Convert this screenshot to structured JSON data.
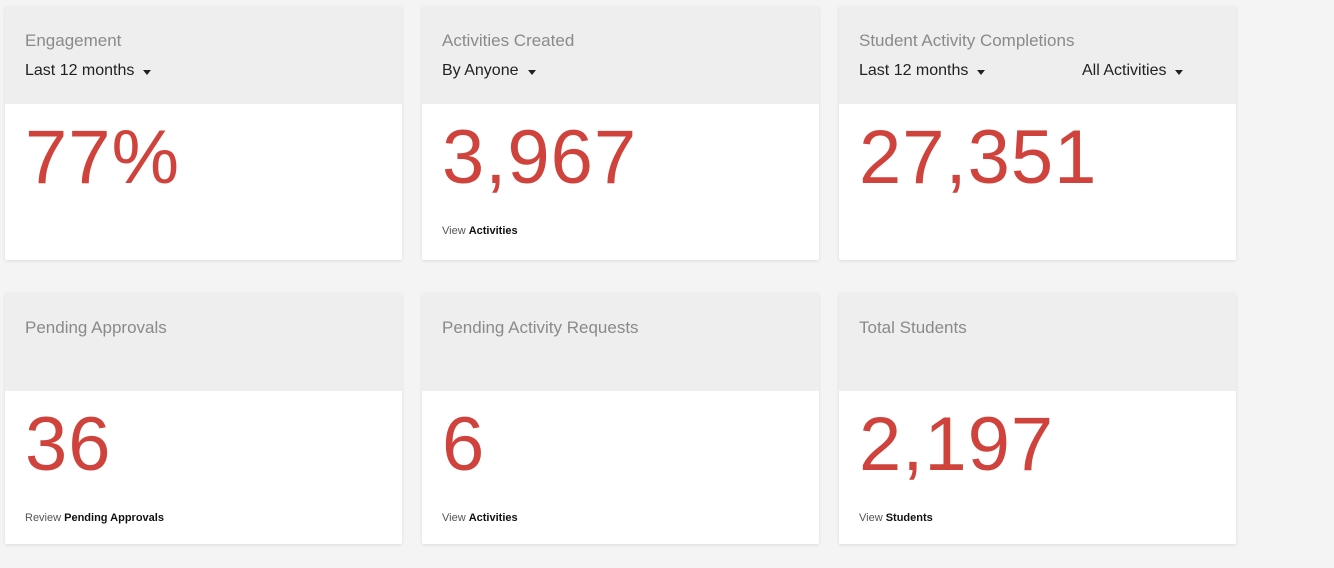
{
  "cards": [
    {
      "title": "Engagement",
      "dropdown1": "Last 12 months",
      "value": "77%"
    },
    {
      "title": "Activities Created",
      "dropdown1": "By Anyone",
      "value": "3,967",
      "link_prefix": "View",
      "link_label": "Activities"
    },
    {
      "title": "Student Activity Completions",
      "dropdown1": "Last 12 months",
      "dropdown2": "All Activities",
      "value": "27,351"
    },
    {
      "title": "Pending Approvals",
      "value": "36",
      "link_prefix": "Review",
      "link_label": "Pending Approvals"
    },
    {
      "title": "Pending Activity Requests",
      "value": "6",
      "link_prefix": "View",
      "link_label": "Activities"
    },
    {
      "title": "Total Students",
      "value": "2,197",
      "link_prefix": "View",
      "link_label": "Students"
    }
  ],
  "colors": {
    "accent": "#d0433c",
    "header_bg": "#eeeeee",
    "page_bg": "#f4f4f4"
  }
}
